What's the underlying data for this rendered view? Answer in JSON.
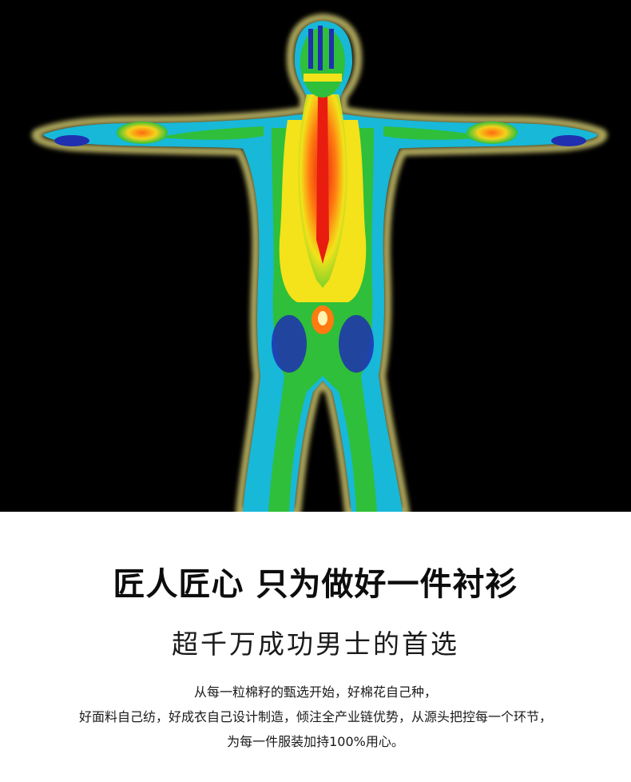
{
  "hero": {
    "image": "thermal-body-image",
    "colors": {
      "background": "#000000",
      "cold": "#1f2fb0",
      "cool": "#18b8d8",
      "mild": "#2fbf3a",
      "warm": "#f4e21a",
      "hot": "#ff7a10",
      "hottest": "#e81d10",
      "outline": "#c8c06a"
    }
  },
  "text": {
    "headline": "匠人匠心 只为做好一件衬衫",
    "subheadline": "超千万成功男士的首选",
    "body": [
      "从每一粒棉籽的甄选开始，好棉花自己种，",
      "好面料自己纺，好成衣自己设计制造，倾注全产业链优势，从源头把控每一个环节，",
      "为每一件服装加持100%用心。"
    ]
  }
}
